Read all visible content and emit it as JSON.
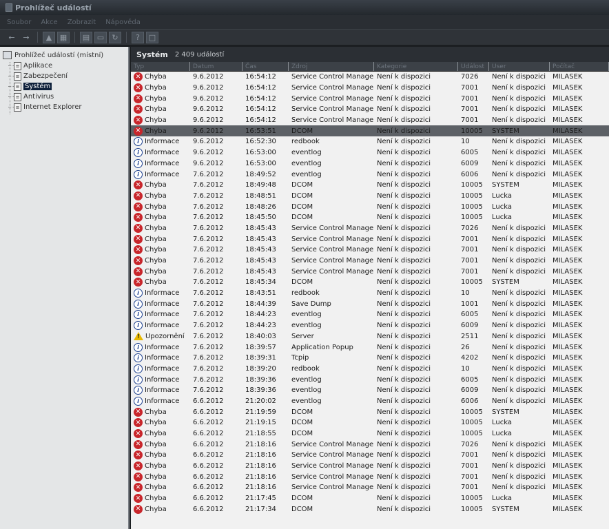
{
  "window": {
    "title": "Prohlížeč událostí"
  },
  "menu": [
    "Soubor",
    "Akce",
    "Zobrazit",
    "Nápověda"
  ],
  "toolbar": {
    "icons": [
      "back-arrow-icon",
      "forward-arrow-icon",
      "up-folder-icon",
      "show-hide-tree-icon",
      "properties-icon",
      "export-icon",
      "refresh-icon",
      "help-icon",
      "new-window-icon"
    ]
  },
  "tree": {
    "root": "Prohlížeč událostí (místní)",
    "items": [
      {
        "label": "Aplikace",
        "selected": false
      },
      {
        "label": "Zabezpečení",
        "selected": false
      },
      {
        "label": "Systém",
        "selected": true
      },
      {
        "label": "Antivirus",
        "selected": false
      },
      {
        "label": "Internet Explorer",
        "selected": false
      }
    ]
  },
  "panel": {
    "title": "Systém",
    "count": "2 409 událostí"
  },
  "columns": [
    "Typ",
    "Datum",
    "Čas",
    "Zdroj",
    "Kategorie",
    "Událost",
    "User",
    "Počítač"
  ],
  "rows": [
    [
      "err",
      "Chyba",
      "9.6.2012",
      "16:54:12",
      "Service Control Manager",
      "Není k dispozici",
      "7026",
      "Není k dispozici",
      "MILASEK"
    ],
    [
      "err",
      "Chyba",
      "9.6.2012",
      "16:54:12",
      "Service Control Manager",
      "Není k dispozici",
      "7001",
      "Není k dispozici",
      "MILASEK"
    ],
    [
      "err",
      "Chyba",
      "9.6.2012",
      "16:54:12",
      "Service Control Manager",
      "Není k dispozici",
      "7001",
      "Není k dispozici",
      "MILASEK"
    ],
    [
      "err",
      "Chyba",
      "9.6.2012",
      "16:54:12",
      "Service Control Manager",
      "Není k dispozici",
      "7001",
      "Není k dispozici",
      "MILASEK"
    ],
    [
      "err",
      "Chyba",
      "9.6.2012",
      "16:54:12",
      "Service Control Manager",
      "Není k dispozici",
      "7001",
      "Není k dispozici",
      "MILASEK"
    ],
    [
      "err",
      "Chyba",
      "9.6.2012",
      "16:53:51",
      "DCOM",
      "Není k dispozici",
      "10005",
      "SYSTEM",
      "MILASEK"
    ],
    [
      "inf",
      "Informace",
      "9.6.2012",
      "16:52:30",
      "redbook",
      "Není k dispozici",
      "10",
      "Není k dispozici",
      "MILASEK"
    ],
    [
      "inf",
      "Informace",
      "9.6.2012",
      "16:53:00",
      "eventlog",
      "Není k dispozici",
      "6005",
      "Není k dispozici",
      "MILASEK"
    ],
    [
      "inf",
      "Informace",
      "9.6.2012",
      "16:53:00",
      "eventlog",
      "Není k dispozici",
      "6009",
      "Není k dispozici",
      "MILASEK"
    ],
    [
      "inf",
      "Informace",
      "7.6.2012",
      "18:49:52",
      "eventlog",
      "Není k dispozici",
      "6006",
      "Není k dispozici",
      "MILASEK"
    ],
    [
      "err",
      "Chyba",
      "7.6.2012",
      "18:49:48",
      "DCOM",
      "Není k dispozici",
      "10005",
      "SYSTEM",
      "MILASEK"
    ],
    [
      "err",
      "Chyba",
      "7.6.2012",
      "18:48:51",
      "DCOM",
      "Není k dispozici",
      "10005",
      "Lucka",
      "MILASEK"
    ],
    [
      "err",
      "Chyba",
      "7.6.2012",
      "18:48:26",
      "DCOM",
      "Není k dispozici",
      "10005",
      "Lucka",
      "MILASEK"
    ],
    [
      "err",
      "Chyba",
      "7.6.2012",
      "18:45:50",
      "DCOM",
      "Není k dispozici",
      "10005",
      "Lucka",
      "MILASEK"
    ],
    [
      "err",
      "Chyba",
      "7.6.2012",
      "18:45:43",
      "Service Control Manager",
      "Není k dispozici",
      "7026",
      "Není k dispozici",
      "MILASEK"
    ],
    [
      "err",
      "Chyba",
      "7.6.2012",
      "18:45:43",
      "Service Control Manager",
      "Není k dispozici",
      "7001",
      "Není k dispozici",
      "MILASEK"
    ],
    [
      "err",
      "Chyba",
      "7.6.2012",
      "18:45:43",
      "Service Control Manager",
      "Není k dispozici",
      "7001",
      "Není k dispozici",
      "MILASEK"
    ],
    [
      "err",
      "Chyba",
      "7.6.2012",
      "18:45:43",
      "Service Control Manager",
      "Není k dispozici",
      "7001",
      "Není k dispozici",
      "MILASEK"
    ],
    [
      "err",
      "Chyba",
      "7.6.2012",
      "18:45:43",
      "Service Control Manager",
      "Není k dispozici",
      "7001",
      "Není k dispozici",
      "MILASEK"
    ],
    [
      "err",
      "Chyba",
      "7.6.2012",
      "18:45:34",
      "DCOM",
      "Není k dispozici",
      "10005",
      "SYSTEM",
      "MILASEK"
    ],
    [
      "inf",
      "Informace",
      "7.6.2012",
      "18:43:51",
      "redbook",
      "Není k dispozici",
      "10",
      "Není k dispozici",
      "MILASEK"
    ],
    [
      "inf",
      "Informace",
      "7.6.2012",
      "18:44:39",
      "Save Dump",
      "Není k dispozici",
      "1001",
      "Není k dispozici",
      "MILASEK"
    ],
    [
      "inf",
      "Informace",
      "7.6.2012",
      "18:44:23",
      "eventlog",
      "Není k dispozici",
      "6005",
      "Není k dispozici",
      "MILASEK"
    ],
    [
      "inf",
      "Informace",
      "7.6.2012",
      "18:44:23",
      "eventlog",
      "Není k dispozici",
      "6009",
      "Není k dispozici",
      "MILASEK"
    ],
    [
      "wrn",
      "Upozornění",
      "7.6.2012",
      "18:40:03",
      "Server",
      "Není k dispozici",
      "2511",
      "Není k dispozici",
      "MILASEK"
    ],
    [
      "inf",
      "Informace",
      "7.6.2012",
      "18:39:57",
      "Application Popup",
      "Není k dispozici",
      "26",
      "Není k dispozici",
      "MILASEK"
    ],
    [
      "inf",
      "Informace",
      "7.6.2012",
      "18:39:31",
      "Tcpip",
      "Není k dispozici",
      "4202",
      "Není k dispozici",
      "MILASEK"
    ],
    [
      "inf",
      "Informace",
      "7.6.2012",
      "18:39:20",
      "redbook",
      "Není k dispozici",
      "10",
      "Není k dispozici",
      "MILASEK"
    ],
    [
      "inf",
      "Informace",
      "7.6.2012",
      "18:39:36",
      "eventlog",
      "Není k dispozici",
      "6005",
      "Není k dispozici",
      "MILASEK"
    ],
    [
      "inf",
      "Informace",
      "7.6.2012",
      "18:39:36",
      "eventlog",
      "Není k dispozici",
      "6009",
      "Není k dispozici",
      "MILASEK"
    ],
    [
      "inf",
      "Informace",
      "6.6.2012",
      "21:20:02",
      "eventlog",
      "Není k dispozici",
      "6006",
      "Není k dispozici",
      "MILASEK"
    ],
    [
      "err",
      "Chyba",
      "6.6.2012",
      "21:19:59",
      "DCOM",
      "Není k dispozici",
      "10005",
      "SYSTEM",
      "MILASEK"
    ],
    [
      "err",
      "Chyba",
      "6.6.2012",
      "21:19:15",
      "DCOM",
      "Není k dispozici",
      "10005",
      "Lucka",
      "MILASEK"
    ],
    [
      "err",
      "Chyba",
      "6.6.2012",
      "21:18:55",
      "DCOM",
      "Není k dispozici",
      "10005",
      "Lucka",
      "MILASEK"
    ],
    [
      "err",
      "Chyba",
      "6.6.2012",
      "21:18:16",
      "Service Control Manager",
      "Není k dispozici",
      "7026",
      "Není k dispozici",
      "MILASEK"
    ],
    [
      "err",
      "Chyba",
      "6.6.2012",
      "21:18:16",
      "Service Control Manager",
      "Není k dispozici",
      "7001",
      "Není k dispozici",
      "MILASEK"
    ],
    [
      "err",
      "Chyba",
      "6.6.2012",
      "21:18:16",
      "Service Control Manager",
      "Není k dispozici",
      "7001",
      "Není k dispozici",
      "MILASEK"
    ],
    [
      "err",
      "Chyba",
      "6.6.2012",
      "21:18:16",
      "Service Control Manager",
      "Není k dispozici",
      "7001",
      "Není k dispozici",
      "MILASEK"
    ],
    [
      "err",
      "Chyba",
      "6.6.2012",
      "21:18:16",
      "Service Control Manager",
      "Není k dispozici",
      "7001",
      "Není k dispozici",
      "MILASEK"
    ],
    [
      "err",
      "Chyba",
      "6.6.2012",
      "21:17:45",
      "DCOM",
      "Není k dispozici",
      "10005",
      "Lucka",
      "MILASEK"
    ],
    [
      "err",
      "Chyba",
      "6.6.2012",
      "21:17:34",
      "DCOM",
      "Není k dispozici",
      "10005",
      "SYSTEM",
      "MILASEK"
    ]
  ],
  "selected_row": 5
}
